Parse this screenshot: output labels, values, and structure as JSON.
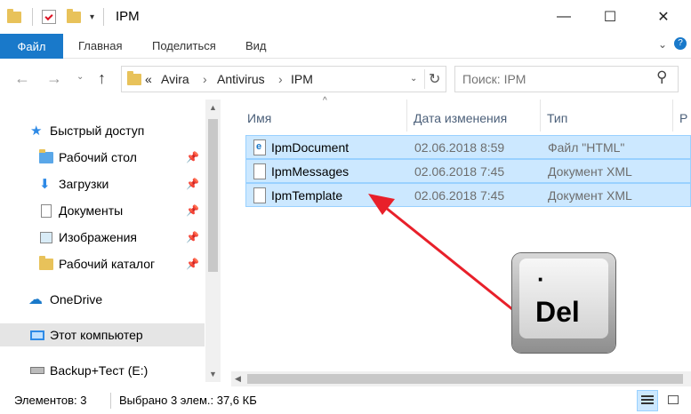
{
  "window": {
    "title": "IPM",
    "minimize": "—",
    "maximize": "☐",
    "close": "✕"
  },
  "ribbon": {
    "file": "Файл",
    "home": "Главная",
    "share": "Поделиться",
    "view": "Вид"
  },
  "address": {
    "crumbs": [
      "«",
      "Avira",
      "›",
      "Antivirus",
      "›",
      "IPM"
    ]
  },
  "search": {
    "placeholder": "Поиск: IPM"
  },
  "nav": {
    "quick_access": "Быстрый доступ",
    "items": [
      {
        "label": "Рабочий стол",
        "icon": "desktop-folder-icon"
      },
      {
        "label": "Загрузки",
        "icon": "downloads-icon"
      },
      {
        "label": "Документы",
        "icon": "documents-icon"
      },
      {
        "label": "Изображения",
        "icon": "pictures-icon"
      },
      {
        "label": "Рабочий каталог",
        "icon": "folder-icon"
      }
    ],
    "onedrive": "OneDrive",
    "this_pc": "Этот компьютер",
    "drive": "Backup+Тест (E:)"
  },
  "columns": {
    "name": "Имя",
    "date": "Дата изменения",
    "type": "Тип",
    "size": "Р"
  },
  "files": [
    {
      "name": "IpmDocument",
      "date": "02.06.2018 8:59",
      "type": "Файл \"HTML\""
    },
    {
      "name": "IpmMessages",
      "date": "02.06.2018 7:45",
      "type": "Документ XML"
    },
    {
      "name": "IpmTemplate",
      "date": "02.06.2018 7:45",
      "type": "Документ XML"
    }
  ],
  "status": {
    "count": "Элементов: 3",
    "selected": "Выбрано 3 элем.: 37,6 КБ"
  },
  "key": {
    "dot": "·",
    "label": "Del"
  },
  "colors": {
    "accent": "#1979ca",
    "selection": "#cce8ff",
    "arrow": "#e8202a"
  }
}
